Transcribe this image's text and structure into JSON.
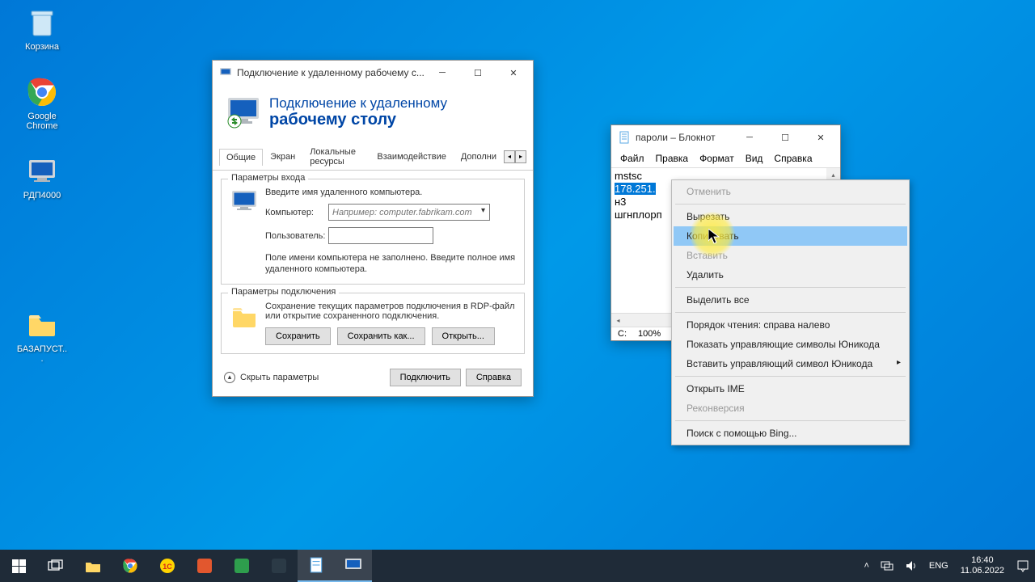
{
  "desktop": {
    "icons": [
      {
        "label": "Корзина"
      },
      {
        "label": "Google Chrome"
      },
      {
        "label": "РДП4000"
      },
      {
        "label": "БАЗАПУСТ..."
      }
    ]
  },
  "rdp": {
    "title": "Подключение к удаленному рабочему с...",
    "header_line1": "Подключение к удаленному",
    "header_line2": "рабочему столу",
    "tabs": [
      "Общие",
      "Экран",
      "Локальные ресурсы",
      "Взаимодействие",
      "Дополни"
    ],
    "active_tab": 0,
    "login_group": {
      "legend": "Параметры входа",
      "prompt": "Введите имя удаленного компьютера.",
      "computer_label": "Компьютер:",
      "computer_placeholder": "Например: computer.fabrikam.com",
      "user_label": "Пользователь:",
      "hint": "Поле имени компьютера не заполнено. Введите полное имя удаленного компьютера."
    },
    "conn_group": {
      "legend": "Параметры подключения",
      "text": "Сохранение текущих параметров подключения в RDP-файл или открытие сохраненного подключения.",
      "buttons": [
        "Сохранить",
        "Сохранить как...",
        "Открыть..."
      ]
    },
    "hide_params": "Скрыть параметры",
    "connect": "Подключить",
    "help": "Справка"
  },
  "notepad": {
    "title": "пароли – Блокнот",
    "menus": [
      "Файл",
      "Правка",
      "Формат",
      "Вид",
      "Справка"
    ],
    "lines": {
      "l0": "mstsc",
      "l1_selected": "178.251.",
      "l2": "н3",
      "l3": "шгнплорп"
    },
    "status": {
      "cursor": "С:",
      "zoom": "100%"
    }
  },
  "context_menu": {
    "items": [
      {
        "label": "Отменить",
        "disabled": true
      },
      {
        "sep": true
      },
      {
        "label": "Вырезать"
      },
      {
        "label": "Копировать",
        "hovered": true
      },
      {
        "label": "Вставить",
        "disabled": true
      },
      {
        "label": "Удалить"
      },
      {
        "sep": true
      },
      {
        "label": "Выделить все"
      },
      {
        "sep": true
      },
      {
        "label": "Порядок чтения: справа налево"
      },
      {
        "label": "Показать управляющие символы Юникода"
      },
      {
        "label": "Вставить управляющий символ Юникода",
        "submenu": true
      },
      {
        "sep": true
      },
      {
        "label": "Открыть IME"
      },
      {
        "label": "Реконверсия",
        "disabled": true
      },
      {
        "sep": true
      },
      {
        "label": "Поиск с помощью Bing..."
      }
    ]
  },
  "taskbar": {
    "lang": "ENG",
    "time": "16:40",
    "date": "11.06.2022"
  }
}
